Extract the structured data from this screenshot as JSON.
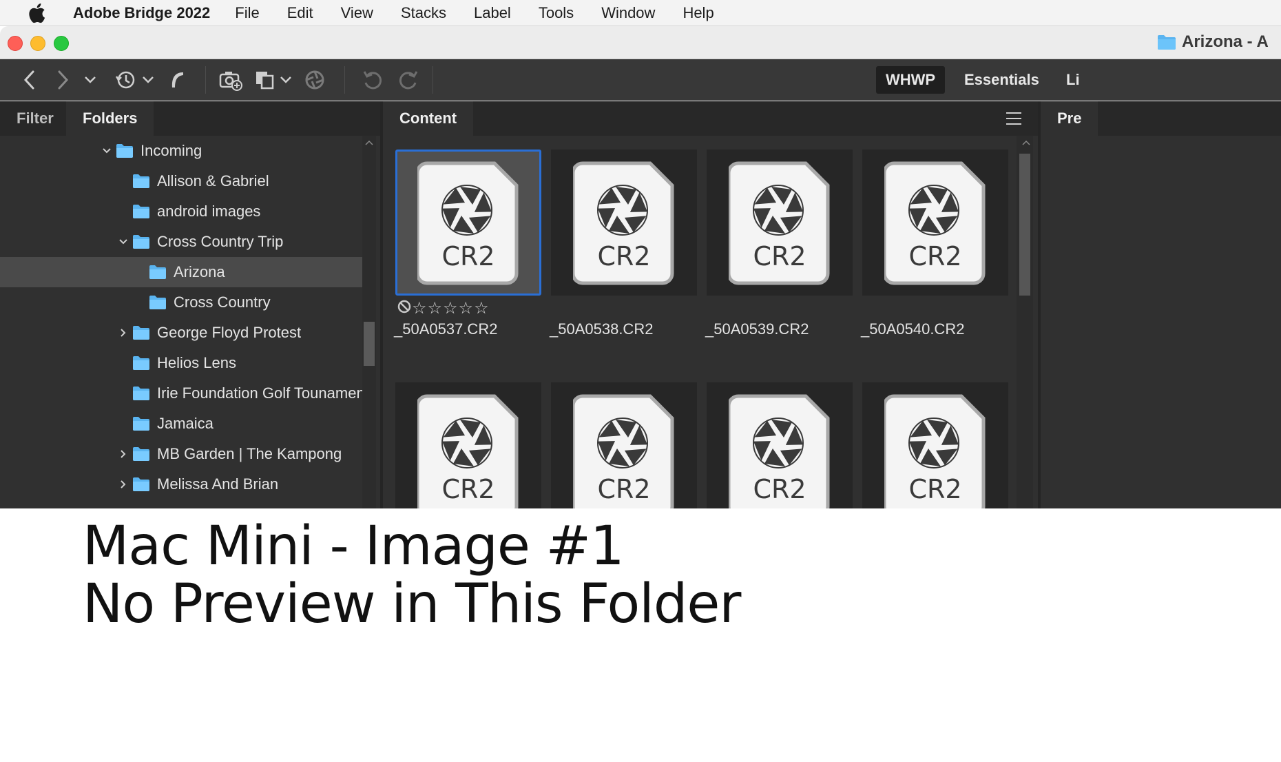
{
  "menubar": {
    "app_name": "Adobe Bridge 2022",
    "items": [
      "File",
      "Edit",
      "View",
      "Stacks",
      "Label",
      "Tools",
      "Window",
      "Help"
    ]
  },
  "window": {
    "title": "Arizona - A"
  },
  "toolbar": {
    "workspaces": [
      {
        "label": "WHWP",
        "active": true
      },
      {
        "label": "Essentials",
        "active": false
      },
      {
        "label": "Li",
        "active": false
      }
    ]
  },
  "left_panel": {
    "tabs": [
      {
        "label": "Filter",
        "active": false
      },
      {
        "label": "Folders",
        "active": true
      }
    ],
    "tree": [
      {
        "label": "Incoming",
        "depth": 0,
        "disclosure": "expanded",
        "selected": false
      },
      {
        "label": "Allison & Gabriel",
        "depth": 1,
        "disclosure": "none",
        "selected": false
      },
      {
        "label": "android images",
        "depth": 1,
        "disclosure": "none",
        "selected": false
      },
      {
        "label": "Cross Country Trip",
        "depth": 1,
        "disclosure": "expanded",
        "selected": false
      },
      {
        "label": "Arizona",
        "depth": 2,
        "disclosure": "none",
        "selected": true
      },
      {
        "label": "Cross Country",
        "depth": 2,
        "disclosure": "none",
        "selected": false
      },
      {
        "label": "George Floyd Protest",
        "depth": 1,
        "disclosure": "collapsed",
        "selected": false
      },
      {
        "label": "Helios Lens",
        "depth": 1,
        "disclosure": "none",
        "selected": false
      },
      {
        "label": "Irie Foundation Golf Tounament",
        "depth": 1,
        "disclosure": "none",
        "selected": false
      },
      {
        "label": "Jamaica",
        "depth": 1,
        "disclosure": "none",
        "selected": false
      },
      {
        "label": "MB Garden | The Kampong",
        "depth": 1,
        "disclosure": "collapsed",
        "selected": false
      },
      {
        "label": "Melissa And Brian",
        "depth": 1,
        "disclosure": "collapsed",
        "selected": false
      }
    ]
  },
  "content_panel": {
    "tab_label": "Content",
    "thumbnails": [
      {
        "file_type": "CR2",
        "file_name": "_50A0537.CR2",
        "selected": true,
        "show_rating": true,
        "stars": 0
      },
      {
        "file_type": "CR2",
        "file_name": "_50A0538.CR2",
        "selected": false,
        "show_rating": false
      },
      {
        "file_type": "CR2",
        "file_name": "_50A0539.CR2",
        "selected": false,
        "show_rating": false
      },
      {
        "file_type": "CR2",
        "file_name": "_50A0540.CR2",
        "selected": false,
        "show_rating": false
      },
      {
        "file_type": "CR2",
        "file_name": "",
        "selected": false,
        "show_rating": false
      },
      {
        "file_type": "CR2",
        "file_name": "",
        "selected": false,
        "show_rating": false
      },
      {
        "file_type": "CR2",
        "file_name": "",
        "selected": false,
        "show_rating": false
      },
      {
        "file_type": "CR2",
        "file_name": "",
        "selected": false,
        "show_rating": false
      }
    ]
  },
  "right_panel": {
    "tab_label": "Pre"
  },
  "caption": {
    "line1": "Mac Mini - Image #1",
    "line2": "No Preview in This Folder"
  },
  "colors": {
    "panel_bg": "#303030",
    "selection_border": "#2a6fd6",
    "folder_blue": "#5ab4f0"
  }
}
